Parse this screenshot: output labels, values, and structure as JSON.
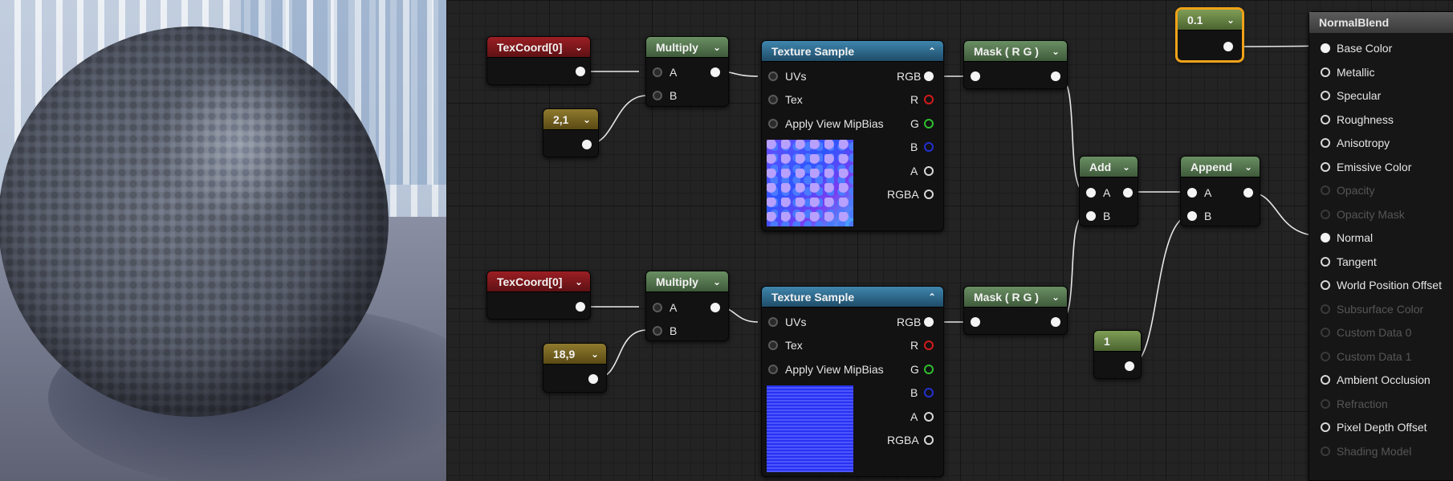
{
  "graph": {
    "texcoord_top": {
      "title": "TexCoord[0]"
    },
    "texcoord_bottom": {
      "title": "TexCoord[0]"
    },
    "const_top": {
      "title": "2,1"
    },
    "const_bottom": {
      "title": "18,9"
    },
    "multiply_top": {
      "title": "Multiply",
      "pin_a": "A",
      "pin_b": "B"
    },
    "multiply_bottom": {
      "title": "Multiply",
      "pin_a": "A",
      "pin_b": "B"
    },
    "texsample_top": {
      "title": "Texture Sample",
      "inputs": [
        "UVs",
        "Tex",
        "Apply View MipBias"
      ],
      "outputs": [
        "RGB",
        "R",
        "G",
        "B",
        "A",
        "RGBA"
      ]
    },
    "texsample_bottom": {
      "title": "Texture Sample",
      "inputs": [
        "UVs",
        "Tex",
        "Apply View MipBias"
      ],
      "outputs": [
        "RGB",
        "R",
        "G",
        "B",
        "A",
        "RGBA"
      ]
    },
    "mask_top": {
      "title": "Mask ( R G )"
    },
    "mask_bottom": {
      "title": "Mask ( R G )"
    },
    "add": {
      "title": "Add",
      "pin_a": "A",
      "pin_b": "B"
    },
    "append": {
      "title": "Append",
      "pin_a": "A",
      "pin_b": "B"
    },
    "scalar_01": {
      "title": "0.1",
      "selected": true
    },
    "scalar_1": {
      "title": "1"
    },
    "material": {
      "title": "NormalBlend",
      "inputs": [
        {
          "label": "Base Color",
          "enabled": true,
          "connected": true
        },
        {
          "label": "Metallic",
          "enabled": true,
          "connected": false
        },
        {
          "label": "Specular",
          "enabled": true,
          "connected": false
        },
        {
          "label": "Roughness",
          "enabled": true,
          "connected": false
        },
        {
          "label": "Anisotropy",
          "enabled": true,
          "connected": false
        },
        {
          "label": "Emissive Color",
          "enabled": true,
          "connected": false
        },
        {
          "label": "Opacity",
          "enabled": false,
          "connected": false
        },
        {
          "label": "Opacity Mask",
          "enabled": false,
          "connected": false
        },
        {
          "label": "Normal",
          "enabled": true,
          "connected": true
        },
        {
          "label": "Tangent",
          "enabled": true,
          "connected": false
        },
        {
          "label": "World Position Offset",
          "enabled": true,
          "connected": false
        },
        {
          "label": "Subsurface Color",
          "enabled": false,
          "connected": false
        },
        {
          "label": "Custom Data 0",
          "enabled": false,
          "connected": false
        },
        {
          "label": "Custom Data 1",
          "enabled": false,
          "connected": false
        },
        {
          "label": "Ambient Occlusion",
          "enabled": true,
          "connected": false
        },
        {
          "label": "Refraction",
          "enabled": false,
          "connected": false
        },
        {
          "label": "Pixel Depth Offset",
          "enabled": true,
          "connected": false
        },
        {
          "label": "Shading Model",
          "enabled": false,
          "connected": false
        }
      ]
    },
    "colors": {
      "selection": "#f0a218",
      "texcoord": "#9b1f24",
      "math": "#6a8f63",
      "texture": "#3f86ae",
      "constant2": "#8f7a2e",
      "scalar": "#7f9e56"
    }
  }
}
